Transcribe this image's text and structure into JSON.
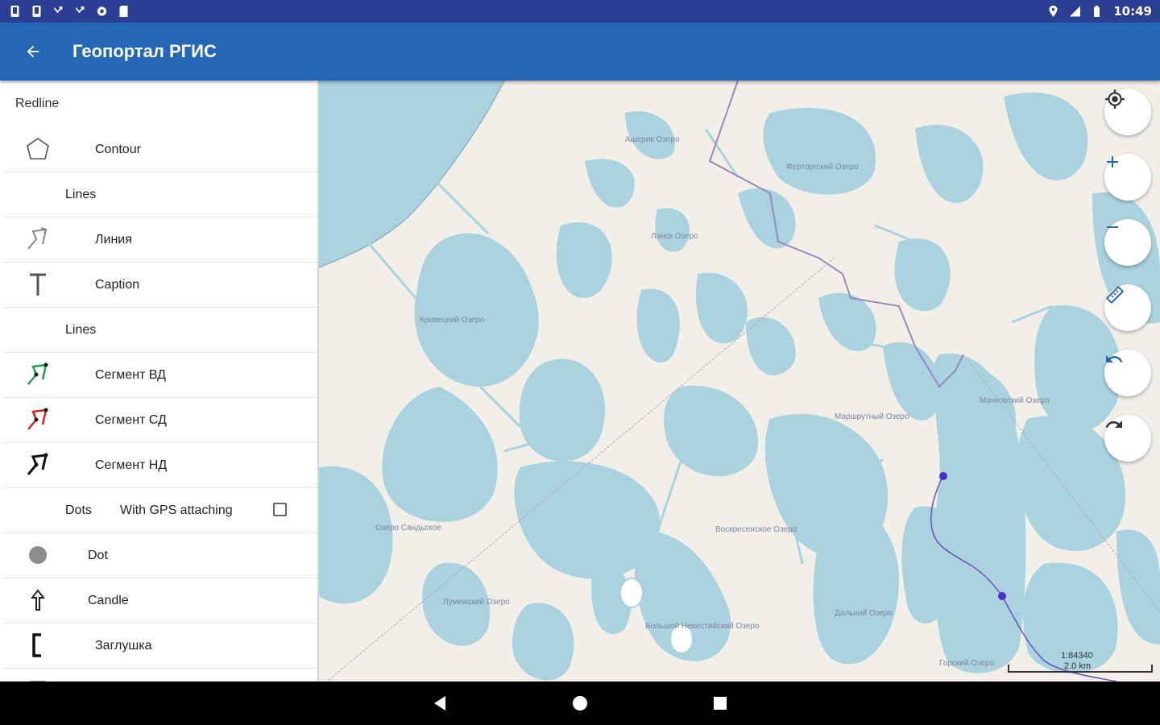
{
  "status_bar": {
    "time": "10:49",
    "left_icons": [
      "sim-icon",
      "sim-icon",
      "call-missed-icon",
      "call-missed-icon",
      "settings-icon",
      "sd-card-icon"
    ],
    "right_icons": [
      "location-icon",
      "signal-icon",
      "battery-icon"
    ]
  },
  "app_bar": {
    "title": "Геопортал РГИС"
  },
  "panel": {
    "section": "Redline",
    "items": [
      {
        "label": "Contour",
        "icon": "polygon-icon"
      },
      {
        "label": "Lines",
        "type": "subheader"
      },
      {
        "label": "Линия",
        "icon": "polyline-icon",
        "color": "#888888"
      },
      {
        "label": "Caption",
        "icon": "text-icon"
      },
      {
        "label": "Lines",
        "type": "subheader"
      },
      {
        "label": "Сегмент ВД",
        "icon": "polyline-icon",
        "color": "#1a9e56"
      },
      {
        "label": "Сегмент СД",
        "icon": "polyline-icon",
        "color": "#e02020"
      },
      {
        "label": "Сегмент НД",
        "icon": "polyline-icon",
        "color": "#111111"
      },
      {
        "label": "Dots",
        "type": "subheader",
        "gps_label": "With GPS attaching",
        "gps_checked": false
      },
      {
        "label": "Dot",
        "icon": "dot-icon"
      },
      {
        "label": "Candle",
        "icon": "candle-icon"
      },
      {
        "label": "Заглушка",
        "icon": "bracket-icon"
      }
    ]
  },
  "map": {
    "labels": [
      "Ашерик Озеро",
      "Ферторгский Озеро",
      "Ланск Озеро",
      "Кривецкий Озеро",
      "Мачковский Озеро",
      "Маршрутный Озеро",
      "Воскресенское Озеро",
      "Озеро Сандьское",
      "Лумежский Озеро",
      "Большой Невестийский Озеро",
      "Дальний Озеро",
      "Горский Озеро"
    ],
    "water_color": "#aad3df",
    "land_color": "#f2efe9",
    "scale_ratio": "1:84340",
    "scale_distance": "2.0 km"
  },
  "fabs": [
    "my-location-icon",
    "zoom-in-icon",
    "zoom-out-icon",
    "ruler-icon",
    "undo-icon",
    "redo-icon"
  ],
  "accent_color": "#2567b7"
}
